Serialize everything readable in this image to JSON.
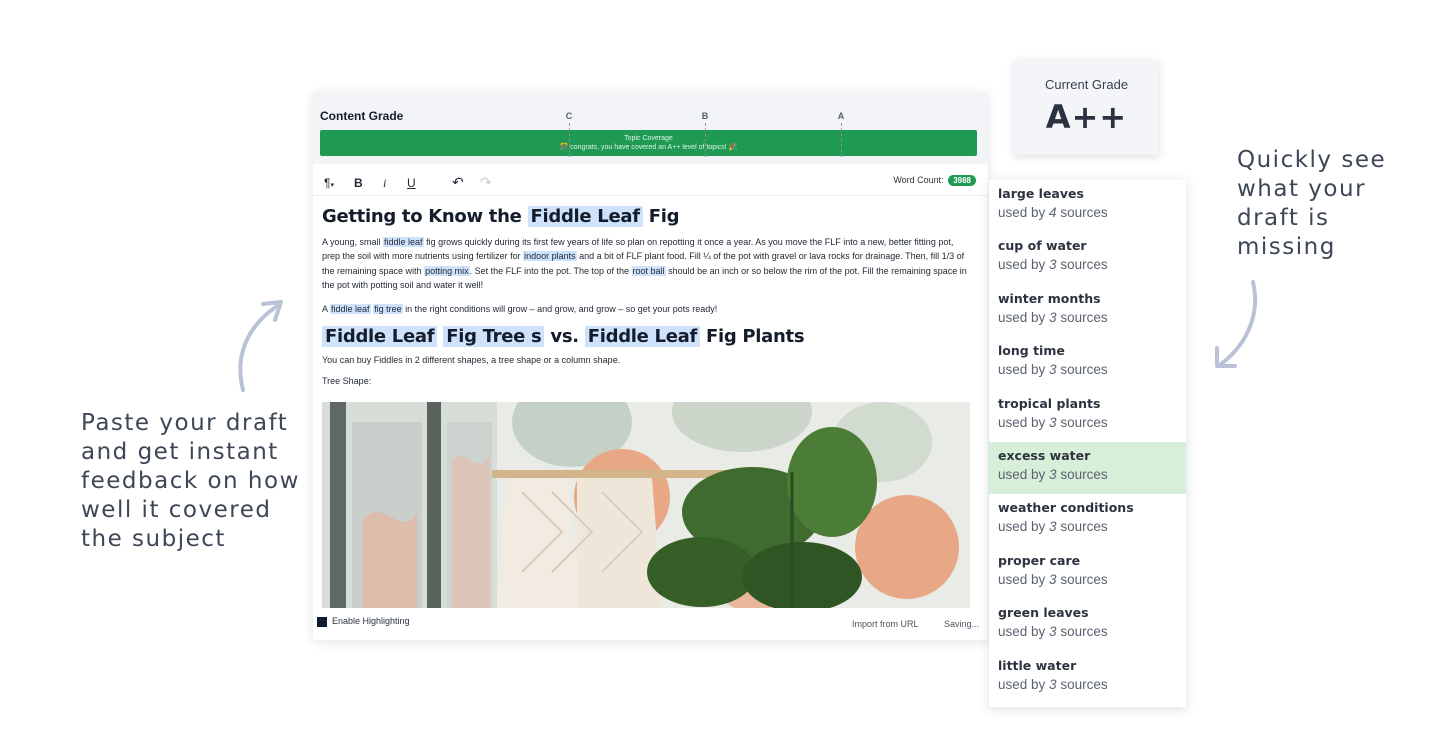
{
  "annotations": {
    "left": "Paste your draft and get instant feedback on how well it covered the subject",
    "right": "Quickly see what your draft is missing"
  },
  "grade_bar": {
    "title": "Content Grade",
    "ticks": [
      "C",
      "B",
      "A"
    ],
    "coverage_title": "Topic Coverage",
    "coverage_msg": "🎊 congrats, you have covered an A++ level of topics! 🎉",
    "bar_color": "#1e9a52"
  },
  "toolbar": {
    "paragraph": "¶",
    "bold": "B",
    "italic": "i",
    "underline": "U",
    "undo": "↶",
    "redo": "↷",
    "word_count_label": "Word Count:",
    "word_count_value": "3988"
  },
  "document": {
    "h1": {
      "pre": "Getting to Know the",
      "hl": "Fiddle Leaf",
      "post": "Fig"
    },
    "p1": {
      "a": "A young, small ",
      "t1": "fiddle leaf",
      "b": " fig grows quickly during its first few years of life so plan on repotting it once a year. As you move the FLF into a new, better fitting pot, prep the soil with more nutrients using fertilizer for ",
      "t2": "indoor plants",
      "c": " and a bit of FLF plant food. Fill ¼ of the pot with gravel or lava rocks for drainage. Then, fill 1/3 of the remaining space with ",
      "t3": "potting mix",
      "d": ". Set the FLF into the pot. The top of the ",
      "t4": "root ball",
      "e": " should be an inch or so below the rim of the pot. Fill the remaining space in the pot with potting soil and water it well!"
    },
    "p2": {
      "a": "A ",
      "t1": "fiddle leaf",
      "t2": "fig tree",
      "b": " in the right conditions will grow – and grow, and grow – so get your pots ready!"
    },
    "h2": {
      "hl1": "Fiddle Leaf",
      "hl2": "Fig Tree s",
      "mid": "vs.",
      "hl3": "Fiddle Leaf",
      "post": "Fig Plants"
    },
    "p3": "You can buy Fiddles in 2 different shapes, a tree shape or a column shape.",
    "p4": "Tree Shape:"
  },
  "footer": {
    "enable_highlighting": "Enable Highlighting",
    "import": "Import from URL",
    "saving": "Saving..."
  },
  "grade": {
    "label": "Current Grade",
    "value": "A++"
  },
  "topics": [
    {
      "name": "large leaves",
      "prefix": "used by ",
      "count": "4",
      "suffix": " sources"
    },
    {
      "name": "cup of water",
      "prefix": "used by ",
      "count": "3",
      "suffix": " sources"
    },
    {
      "name": "winter months",
      "prefix": "used by ",
      "count": "3",
      "suffix": " sources"
    },
    {
      "name": "long time",
      "prefix": "used by ",
      "count": "3",
      "suffix": " sources"
    },
    {
      "name": "tropical plants",
      "prefix": "used by ",
      "count": "3",
      "suffix": " sources"
    },
    {
      "name": "excess water",
      "prefix": "used by ",
      "count": "3",
      "suffix": " sources"
    },
    {
      "name": "weather conditions",
      "prefix": "used by ",
      "count": "3",
      "suffix": " sources"
    },
    {
      "name": "proper care",
      "prefix": "used by ",
      "count": "3",
      "suffix": " sources"
    },
    {
      "name": "green leaves",
      "prefix": "used by ",
      "count": "3",
      "suffix": " sources"
    },
    {
      "name": "little water",
      "prefix": "used by ",
      "count": "3",
      "suffix": " sources"
    }
  ],
  "colors": {
    "highlight": "#cfe2fb",
    "active_topic": "#d7eed8",
    "arrow": "#b9c2d6"
  }
}
